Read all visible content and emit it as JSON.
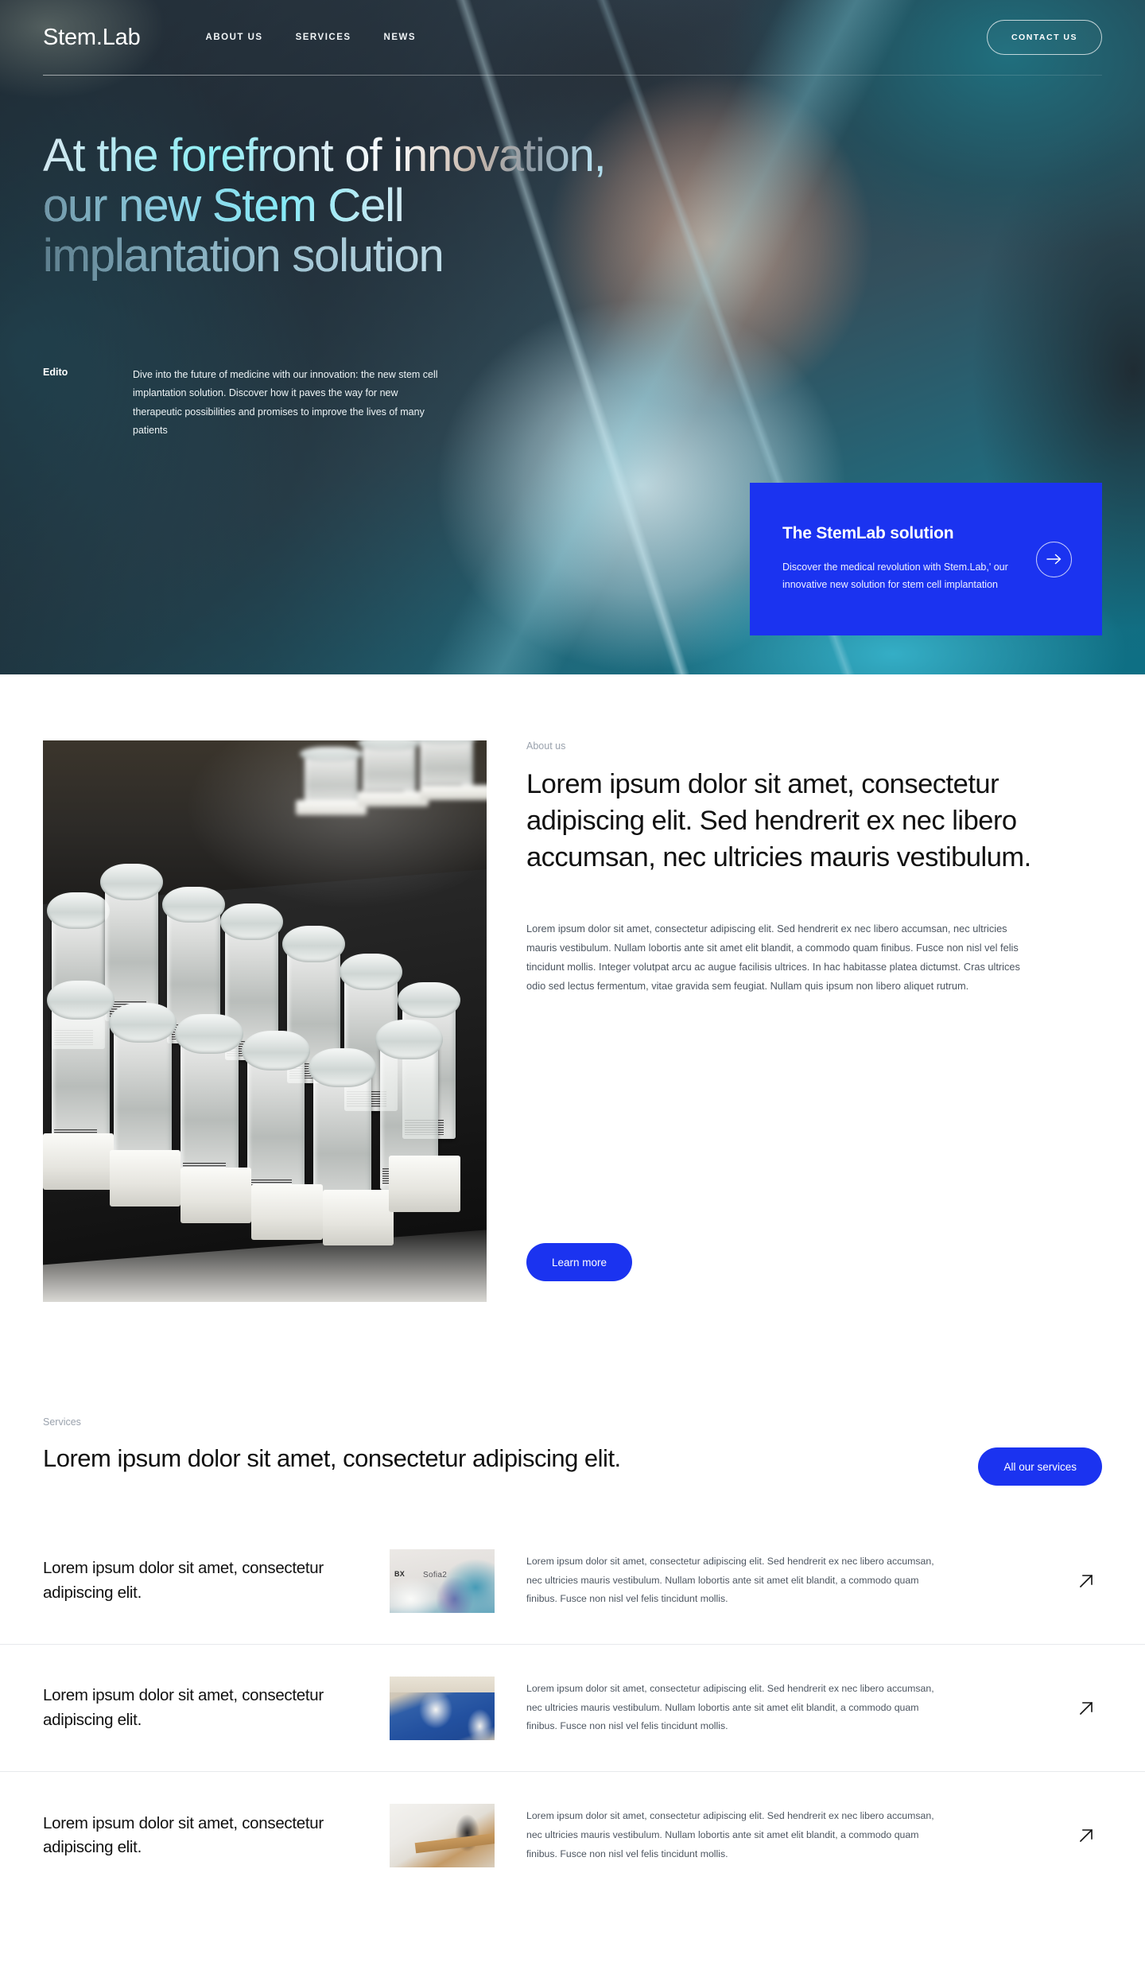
{
  "colors": {
    "brand_blue": "#1b33f0",
    "text_dark": "#111111",
    "text_muted": "#4c5560",
    "eyebrow_grey": "#9aa2ad",
    "divider": "#e7e9ec",
    "page_bg": "#ffffff"
  },
  "nav": {
    "brand": "Stem.Lab",
    "links": [
      {
        "label": "ABOUT US"
      },
      {
        "label": "SERVICES"
      },
      {
        "label": "NEWS"
      }
    ],
    "contact_label": "CONTACT US"
  },
  "hero": {
    "title_lines": [
      "At the forefront of innovation,",
      "our new Stem Cell",
      "implantation solution"
    ],
    "edito_label": "Edito",
    "edito_text": "Dive into the future of medicine with our innovation: the new stem cell implantation solution. Discover how it paves the way for new therapeutic possibilities and promises to improve the lives of many patients",
    "card": {
      "title": "The StemLab solution",
      "body": "Discover the medical revolution with Stem.Lab,' our innovative new solution for stem cell implantation",
      "arrow_icon": "arrow-right-icon"
    },
    "image_alt": "surgeon-in-teal-cap-and-surgical-mask"
  },
  "about": {
    "eyebrow": "About us",
    "heading": "Lorem ipsum dolor sit amet, consectetur adipiscing elit. Sed hendrerit ex nec libero accumsan, nec ultricies mauris vestibulum.",
    "paragraph": "Lorem ipsum dolor sit amet, consectetur adipiscing elit. Sed hendrerit ex nec libero accumsan, nec ultricies mauris vestibulum. Nullam lobortis ante sit amet elit blandit, a commodo quam finibus. Fusce non nisl vel felis tincidunt mollis. Integer volutpat arcu ac augue facilisis ultrices. In hac habitasse platea dictumst. Cras ultrices odio sed lectus fermentum, vitae gravida sem feugiat. Nullam quis ipsum non libero aliquet rutrum.",
    "cta_label": "Learn more",
    "image_alt": "rack-of-clear-cryogenic-sample-vials"
  },
  "services": {
    "eyebrow": "Services",
    "heading": "Lorem ipsum dolor sit amet, consectetur adipiscing elit.",
    "cta_label": "All our services",
    "rows": [
      {
        "title": "Lorem ipsum dolor sit amet, consectetur adipiscing elit.",
        "description": "Lorem ipsum dolor sit amet, consectetur adipiscing elit. Sed hendrerit ex nec libero accumsan, nec ultricies mauris vestibulum. Nullam lobortis ante sit amet elit blandit, a commodo quam finibus. Fusce non nisl vel felis tincidunt mollis.",
        "thumb_alt": "lab-bench-with-bx-sofia2-analyzer",
        "thumb_label_1": "BX",
        "thumb_label_2": "Sofia2",
        "arrow_icon": "arrow-up-right-icon"
      },
      {
        "title": "Lorem ipsum dolor sit amet, consectetur adipiscing elit.",
        "description": "Lorem ipsum dolor sit amet, consectetur adipiscing elit. Sed hendrerit ex nec libero accumsan, nec ultricies mauris vestibulum. Nullam lobortis ante sit amet elit blandit, a commodo quam finibus. Fusce non nisl vel felis tincidunt mollis.",
        "thumb_alt": "surgeons-in-blue-scrubs-with-white-gloves",
        "arrow_icon": "arrow-up-right-icon"
      },
      {
        "title": "Lorem ipsum dolor sit amet, consectetur adipiscing elit.",
        "description": "Lorem ipsum dolor sit amet, consectetur adipiscing elit. Sed hendrerit ex nec libero accumsan, nec ultricies mauris vestibulum. Nullam lobortis ante sit amet elit blandit, a commodo quam finibus. Fusce non nisl vel felis tincidunt mollis.",
        "thumb_alt": "technician-in-white-coverall-at-workbench",
        "arrow_icon": "arrow-up-right-icon"
      }
    ]
  }
}
